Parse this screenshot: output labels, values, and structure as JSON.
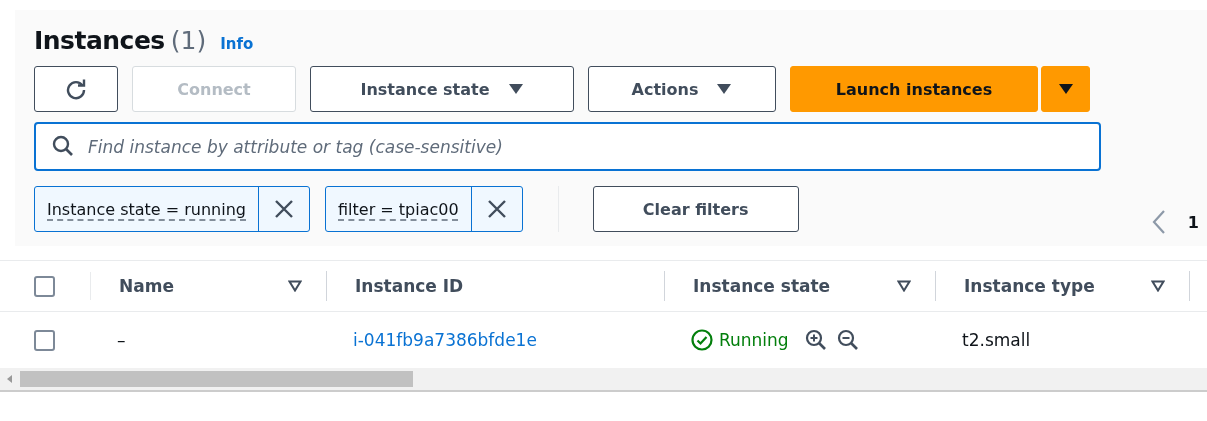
{
  "header": {
    "title": "Instances",
    "count": "(1)",
    "info_link": "Info"
  },
  "toolbar": [
    {
      "kind": "refresh",
      "disabled": false
    },
    {
      "kind": "plain",
      "label": "Connect",
      "disabled": true
    },
    {
      "kind": "dropdown",
      "label": "Instance state",
      "disabled": false
    },
    {
      "kind": "dropdown",
      "label": "Actions",
      "disabled": false
    },
    {
      "kind": "primary-split",
      "label": "Launch instances",
      "disabled": false
    }
  ],
  "search": {
    "placeholder": "Find instance by attribute or tag (case-sensitive)"
  },
  "filters": [
    {
      "label": "Instance state = running"
    },
    {
      "label": "filter = tpiac00"
    }
  ],
  "clear_button": "Clear filters",
  "pagination": {
    "page": "1"
  },
  "table": {
    "all_checked": false,
    "columns": [
      {
        "label": "Name",
        "sortable": true
      },
      {
        "label": "Instance ID",
        "sortable": false
      },
      {
        "label": "Instance state",
        "sortable": true
      },
      {
        "label": "Instance type",
        "sortable": true
      }
    ],
    "rows": [
      {
        "checked": false,
        "name": "–",
        "instance_id": "i-041fb9a7386bfde1e",
        "state": "Running",
        "type": "t2.small"
      }
    ]
  }
}
